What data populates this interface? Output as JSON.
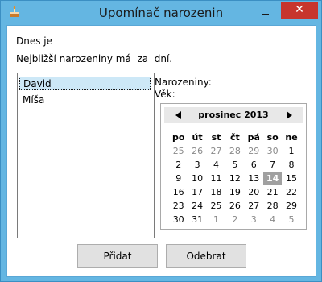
{
  "window": {
    "title": "Upomínač narozenin",
    "close_glyph": "✕"
  },
  "main": {
    "today_label": "Dnes je",
    "nearest_label": "Nejbližší narozeniny má  za  dní.",
    "birthday_label": "Narozeniny:",
    "age_label": "Věk:"
  },
  "people": {
    "items": [
      {
        "label": "David",
        "selected": true
      },
      {
        "label": "Míša",
        "selected": false
      }
    ]
  },
  "calendar": {
    "month": "prosinec 2013",
    "weekdays": [
      "po",
      "út",
      "st",
      "čt",
      "pá",
      "so",
      "ne"
    ],
    "weeks": [
      [
        "25",
        "26",
        "27",
        "28",
        "29",
        "30",
        "1"
      ],
      [
        "2",
        "3",
        "4",
        "5",
        "6",
        "7",
        "8"
      ],
      [
        "9",
        "10",
        "11",
        "12",
        "13",
        "14",
        "15"
      ],
      [
        "16",
        "17",
        "18",
        "19",
        "20",
        "21",
        "22"
      ],
      [
        "23",
        "24",
        "25",
        "26",
        "27",
        "28",
        "29"
      ],
      [
        "30",
        "31",
        "1",
        "2",
        "3",
        "4",
        "5"
      ]
    ],
    "today": "14"
  },
  "buttons": {
    "add_label": "Přidat",
    "remove_label": "Odebrat"
  },
  "icons": {
    "app": "birthday-cake-icon",
    "minimize": "minimize-icon",
    "close": "close-icon",
    "prev": "chevron-left-icon",
    "next": "chevron-right-icon"
  }
}
